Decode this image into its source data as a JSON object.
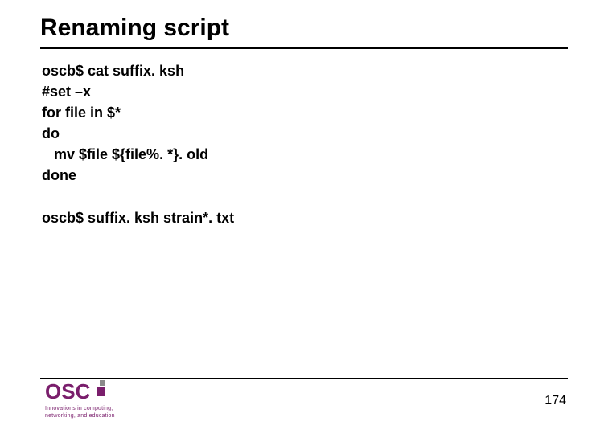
{
  "slide": {
    "title": "Renaming script",
    "code": {
      "line1": "oscb$ cat suffix. ksh",
      "line2": "#set –x",
      "line3": "for file in $*",
      "line4": "do",
      "line5": "   mv $file ${file%. *}. old",
      "line6": "done",
      "line7": "oscb$ suffix. ksh strain*. txt"
    },
    "logo": {
      "text": "OSC",
      "tagline1": "Innovations in computing,",
      "tagline2": "networking, and education"
    },
    "page_number": "174"
  }
}
